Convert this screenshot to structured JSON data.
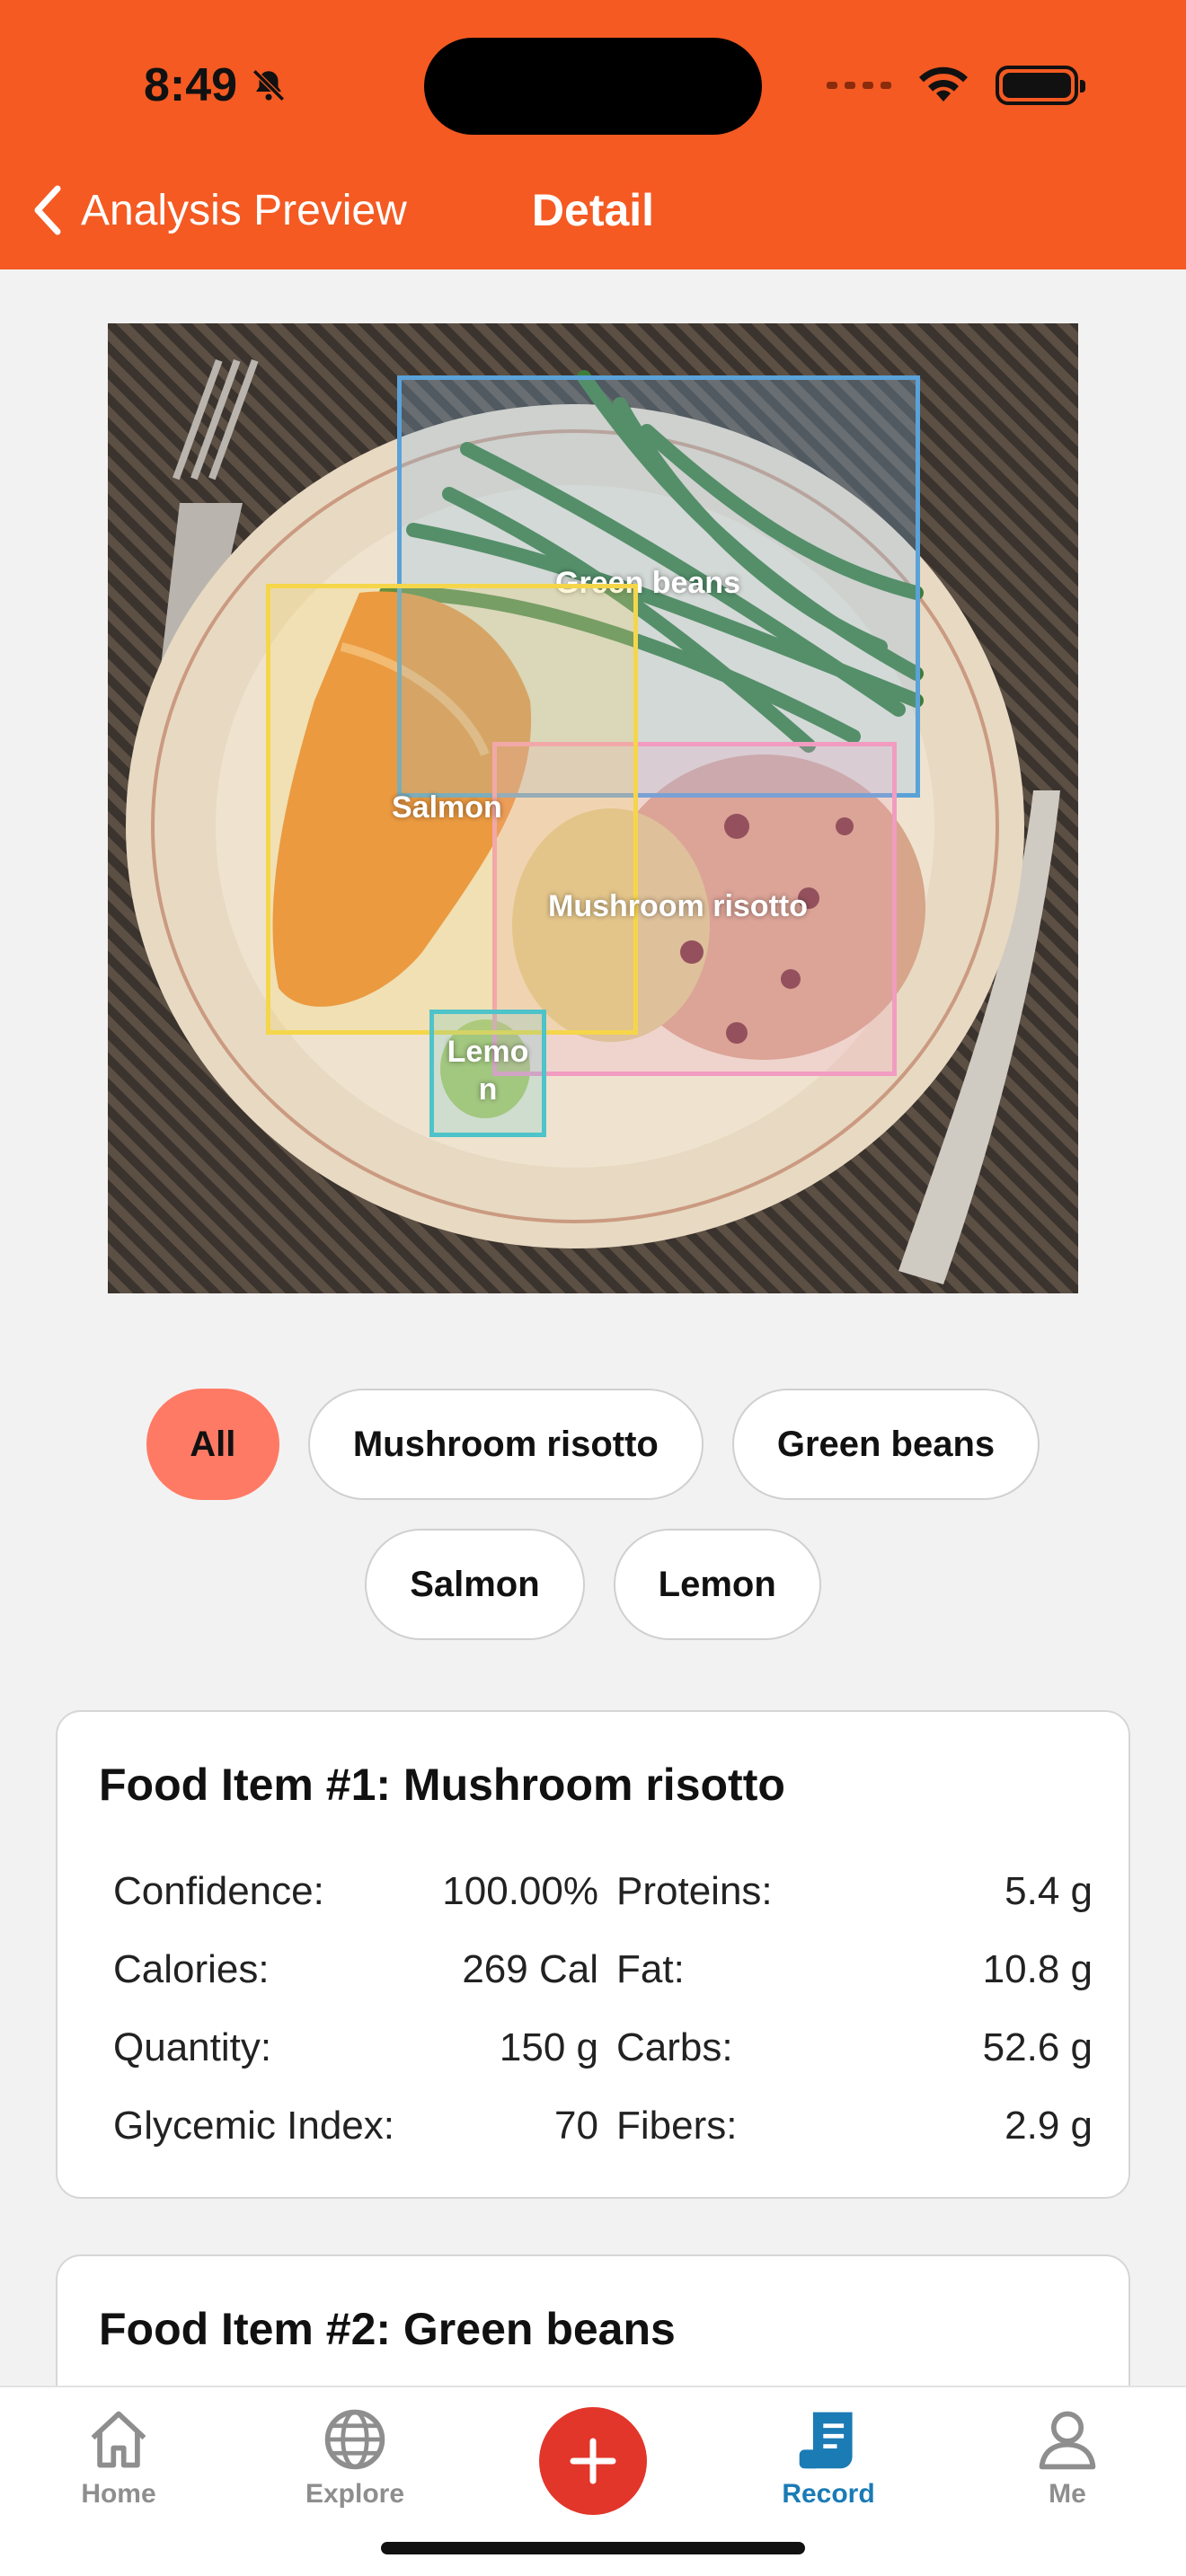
{
  "status": {
    "time": "8:49"
  },
  "nav": {
    "back_label": "Analysis Preview",
    "title": "Detail"
  },
  "detections": [
    {
      "label": "Green beans",
      "color": "#5aa2d8"
    },
    {
      "label": "Salmon",
      "color": "#f5d64a"
    },
    {
      "label": "Mushroom risotto",
      "color": "#f19cc0"
    },
    {
      "label": "Lemo\nn",
      "color": "#4ec3c9"
    }
  ],
  "filters": {
    "row1": [
      "All",
      "Mushroom risotto",
      "Green beans"
    ],
    "row2": [
      "Salmon",
      "Lemon"
    ],
    "active": "All"
  },
  "cards": [
    {
      "title": "Food Item #1: Mushroom risotto",
      "left": [
        {
          "label": "Confidence:",
          "value": "100.00%"
        },
        {
          "label": "Calories:",
          "value": "269 Cal"
        },
        {
          "label": "Quantity:",
          "value": "150 g"
        },
        {
          "label": "Glycemic Index:",
          "value": "70"
        }
      ],
      "right": [
        {
          "label": "Proteins:",
          "value": "5.4 g"
        },
        {
          "label": "Fat:",
          "value": "10.8 g"
        },
        {
          "label": "Carbs:",
          "value": "52.6 g"
        },
        {
          "label": "Fibers:",
          "value": "2.9 g"
        }
      ]
    },
    {
      "title": "Food Item #2: Green beans"
    }
  ],
  "tabs": [
    {
      "label": "Home",
      "icon": "home-icon"
    },
    {
      "label": "Explore",
      "icon": "globe-icon"
    },
    {
      "label": "Record",
      "icon": "receipt-icon",
      "active": true
    },
    {
      "label": "Me",
      "icon": "person-icon"
    }
  ],
  "colors": {
    "brand": "#f45a22",
    "chip_active": "#ff7a65",
    "add_button": "#e2362b",
    "tab_active": "#1a7bb5"
  }
}
